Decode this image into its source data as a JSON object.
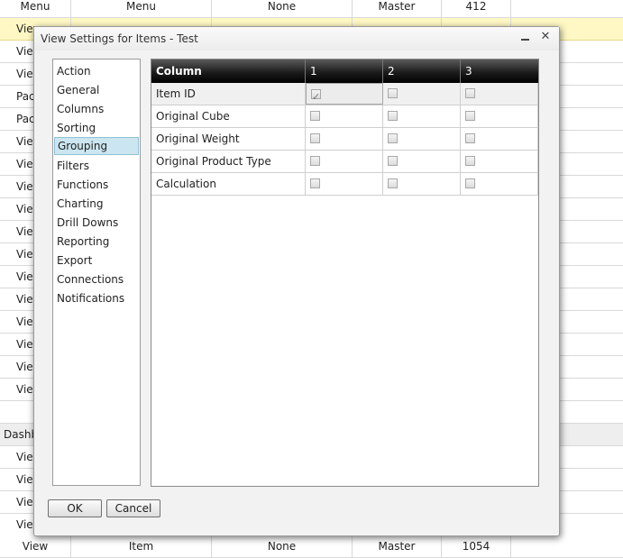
{
  "background": {
    "top_row": [
      "Menu",
      "Menu",
      "None",
      "Master",
      "412"
    ],
    "bottom_row": [
      "View",
      "Item",
      "None",
      "Master",
      "1054"
    ],
    "left_cells": [
      "View",
      "View",
      "View",
      "Pack",
      "Pack",
      "View",
      "View",
      "View",
      "View",
      "View",
      "View",
      "View",
      "View",
      "View",
      "View",
      "View",
      "View",
      "Dashbo",
      "View",
      "View",
      "View",
      "View"
    ]
  },
  "dialog": {
    "title": "View Settings for Items - Test",
    "nav_items": [
      "Action",
      "General",
      "Columns",
      "Sorting",
      "Grouping",
      "Filters",
      "Functions",
      "Charting",
      "Drill Downs",
      "Reporting",
      "Export",
      "Connections",
      "Notifications"
    ],
    "selected_nav": "Grouping",
    "grid": {
      "headers": [
        "Column",
        "1",
        "2",
        "3"
      ],
      "rows": [
        {
          "name": "Item ID",
          "checks": [
            true,
            false,
            false
          ]
        },
        {
          "name": "Original Cube",
          "checks": [
            false,
            false,
            false
          ]
        },
        {
          "name": "Original Weight",
          "checks": [
            false,
            false,
            false
          ]
        },
        {
          "name": "Original Product Type",
          "checks": [
            false,
            false,
            false
          ]
        },
        {
          "name": "Calculation",
          "checks": [
            false,
            false,
            false
          ]
        }
      ]
    },
    "ok_label": "OK",
    "cancel_label": "Cancel",
    "close_glyph": "✕"
  },
  "colors": {
    "highlight_row": "#fff8c4",
    "selected_nav": "#cbe6f0",
    "grid_header": "#1c1c1c"
  }
}
